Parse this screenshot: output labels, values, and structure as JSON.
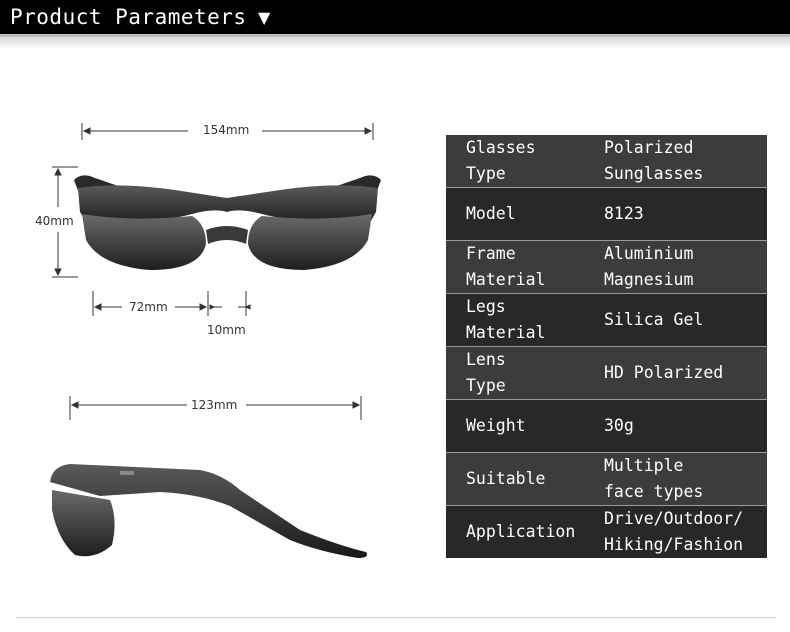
{
  "header": {
    "title": "Product Parameters",
    "arrow": "▼"
  },
  "dimensions": {
    "total_width": "154mm",
    "height": "40mm",
    "lens_width": "72mm",
    "bridge_width": "10mm",
    "temple_length": "123mm"
  },
  "specs": [
    {
      "label": "Glasses\nType",
      "value": "Polarized\nSunglasses"
    },
    {
      "label": "Model",
      "value": "8123"
    },
    {
      "label": "Frame\nMaterial",
      "value": "Aluminium\nMagnesium"
    },
    {
      "label": "Legs\nMaterial",
      "value": "Silica Gel"
    },
    {
      "label": "Lens\nType",
      "value": "HD Polarized"
    },
    {
      "label": "Weight",
      "value": "30g"
    },
    {
      "label": "Suitable",
      "value": "Multiple\nface types"
    },
    {
      "label": "Application",
      "value": "Drive/Outdoor/\nHiking/Fashion"
    }
  ]
}
